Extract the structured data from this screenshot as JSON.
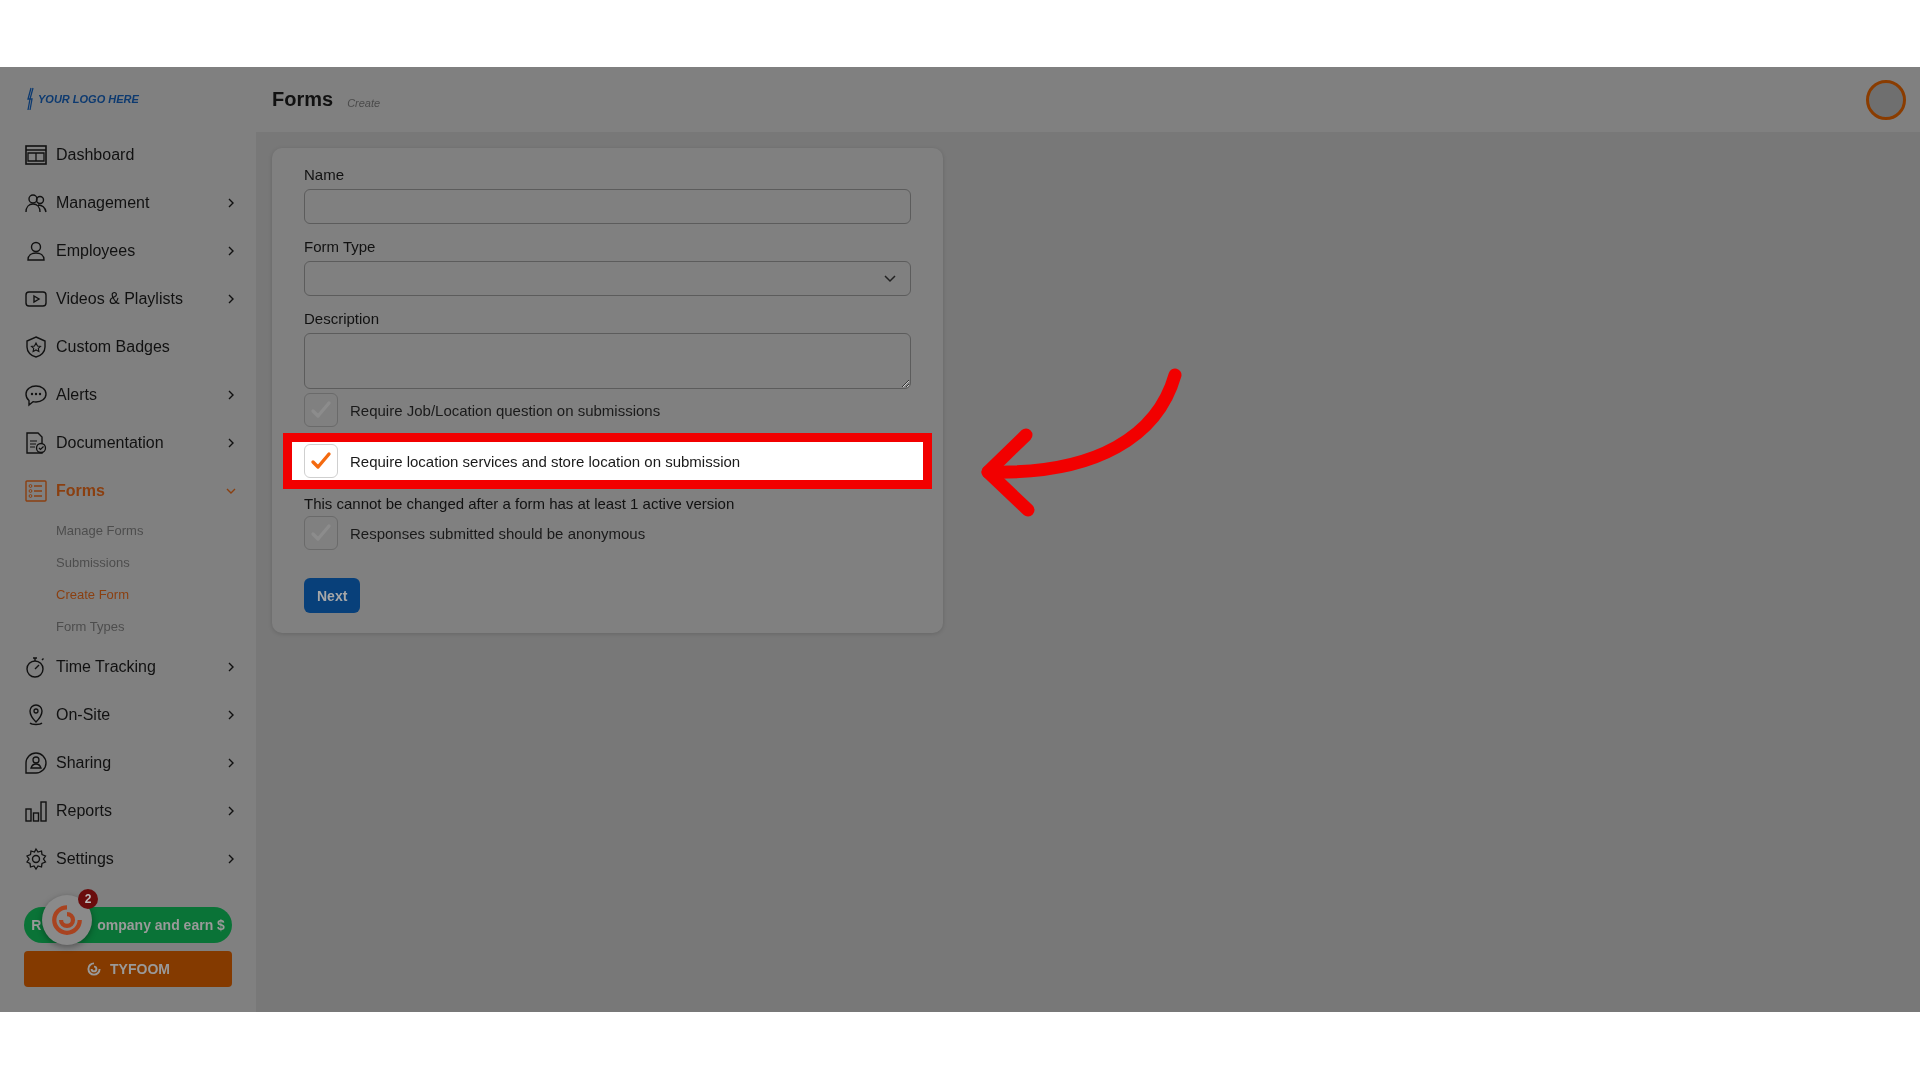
{
  "logo": {
    "text": "YOUR LOGO HERE"
  },
  "header": {
    "title": "Forms",
    "subtitle": "Create"
  },
  "sidebar": {
    "items": [
      {
        "label": "Dashboard",
        "expandable": false,
        "selected": false
      },
      {
        "label": "Management",
        "expandable": true,
        "expanded": false,
        "selected": false
      },
      {
        "label": "Employees",
        "expandable": true,
        "expanded": false,
        "selected": false
      },
      {
        "label": "Videos & Playlists",
        "expandable": true,
        "expanded": false,
        "selected": false
      },
      {
        "label": "Custom Badges",
        "expandable": false,
        "selected": false
      },
      {
        "label": "Alerts",
        "expandable": true,
        "expanded": false,
        "selected": false
      },
      {
        "label": "Documentation",
        "expandable": true,
        "expanded": false,
        "selected": false
      },
      {
        "label": "Forms",
        "expandable": true,
        "expanded": true,
        "selected": true,
        "children": [
          {
            "label": "Manage Forms",
            "selected": false
          },
          {
            "label": "Submissions",
            "selected": false
          },
          {
            "label": "Create Form",
            "selected": true
          },
          {
            "label": "Form Types",
            "selected": false
          }
        ]
      },
      {
        "label": "Time Tracking",
        "expandable": true,
        "expanded": false,
        "selected": false
      },
      {
        "label": "On-Site",
        "expandable": true,
        "expanded": false,
        "selected": false
      },
      {
        "label": "Sharing",
        "expandable": true,
        "expanded": false,
        "selected": false
      },
      {
        "label": "Reports",
        "expandable": true,
        "expanded": false,
        "selected": false
      },
      {
        "label": "Settings",
        "expandable": true,
        "expanded": false,
        "selected": false
      }
    ]
  },
  "form": {
    "fields": [
      {
        "label": "Name",
        "kind": "text"
      },
      {
        "label": "Form Type",
        "kind": "select"
      },
      {
        "label": "Description",
        "kind": "textarea"
      }
    ],
    "checkboxes": [
      {
        "label": "Require Job/Location question on submissions",
        "checked": false,
        "highlighted": false
      },
      {
        "label": "Require location services and store location on submission",
        "checked": true,
        "highlighted": true,
        "note": "This cannot be changed after a form has at least 1 active version"
      },
      {
        "label": "Responses submitted should be anonymous",
        "checked": false,
        "highlighted": false
      }
    ],
    "next_button": "Next"
  },
  "promo": {
    "refer_parts": [
      "R",
      "ompany and earn $"
    ],
    "brand_button": "TYFOOM",
    "chat_badge": "2"
  }
}
